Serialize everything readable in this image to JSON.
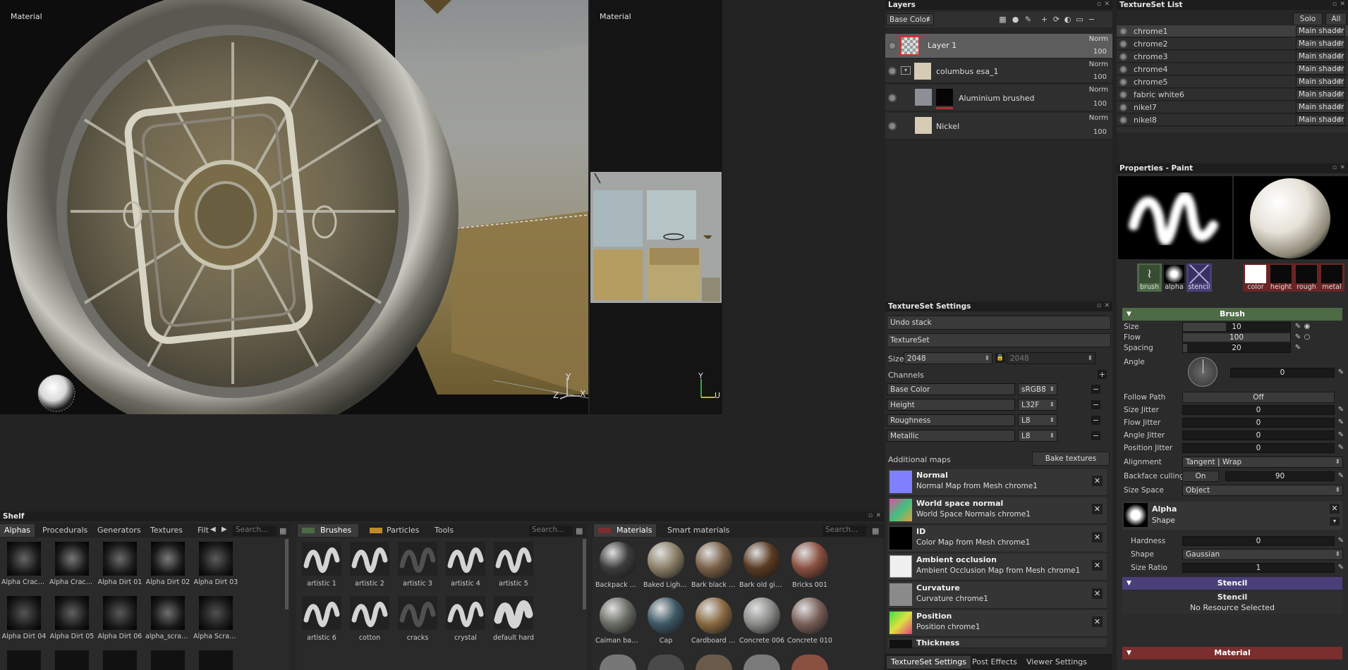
{
  "viewport3d": {
    "label": "Material",
    "axis_y": "Y",
    "axis_z": "Z",
    "axis_x": "X"
  },
  "viewport2d": {
    "label": "Material",
    "axis_y": "Y",
    "axis_u": "U"
  },
  "layers": {
    "title": "Layers",
    "channel": "Base Color",
    "items": [
      {
        "name": "Layer 1",
        "blend": "Norm",
        "opacity": "100"
      },
      {
        "name": "columbus esa_1",
        "blend": "Norm",
        "opacity": "100"
      },
      {
        "name": "Aluminium brushed",
        "blend": "Norm",
        "opacity": "100"
      },
      {
        "name": "Nickel",
        "blend": "Norm",
        "opacity": "100"
      }
    ]
  },
  "textureset_list": {
    "title": "TextureSet List",
    "solo": "Solo",
    "all": "All",
    "items": [
      {
        "name": "chrome1",
        "shader": "Main shader"
      },
      {
        "name": "chrome2",
        "shader": "Main shader"
      },
      {
        "name": "chrome3",
        "shader": "Main shader"
      },
      {
        "name": "chrome4",
        "shader": "Main shader"
      },
      {
        "name": "chrome5",
        "shader": "Main shader"
      },
      {
        "name": "fabric white6",
        "shader": "Main shader"
      },
      {
        "name": "nikel7",
        "shader": "Main shader"
      },
      {
        "name": "nikel8",
        "shader": "Main shader"
      }
    ]
  },
  "ts_settings": {
    "title": "TextureSet Settings",
    "undo": "Undo stack",
    "textureset": "TextureSet",
    "size_label": "Size",
    "size": "2048",
    "size2": "2048",
    "channels_label": "Channels",
    "channels": [
      {
        "name": "Base Color",
        "format": "sRGB8"
      },
      {
        "name": "Height",
        "format": "L32F"
      },
      {
        "name": "Roughness",
        "format": "L8"
      },
      {
        "name": "Metallic",
        "format": "L8"
      }
    ],
    "additional": "Additional maps",
    "bake": "Bake textures",
    "maps": [
      {
        "title": "Normal",
        "sub": "Normal Map from Mesh chrome1"
      },
      {
        "title": "World space normal",
        "sub": "World Space Normals chrome1"
      },
      {
        "title": "ID",
        "sub": "Color Map from Mesh chrome1"
      },
      {
        "title": "Ambient occlusion",
        "sub": "Ambient Occlusion Map from Mesh chrome1"
      },
      {
        "title": "Curvature",
        "sub": "Curvature chrome1"
      },
      {
        "title": "Position",
        "sub": "Position chrome1"
      },
      {
        "title": "Thickness",
        "sub": ""
      }
    ],
    "tabs": [
      "TextureSet Settings",
      "Post Effects",
      "Viewer Settings"
    ]
  },
  "properties": {
    "title": "Properties - Paint",
    "tools": [
      "brush",
      "alpha",
      "stencil"
    ],
    "mats": [
      "color",
      "height",
      "rough",
      "metal"
    ],
    "brush_header": "Brush",
    "size_label": "Size",
    "size": "10",
    "size_frac": 0.4,
    "flow_label": "Flow",
    "flow": "100",
    "flow_frac": 1.0,
    "spacing_label": "Spacing",
    "spacing": "20",
    "spacing_frac": 0.04,
    "angle_label": "Angle",
    "angle": "0",
    "follow_label": "Follow Path",
    "follow": "Off",
    "size_jitter_label": "Size Jitter",
    "size_jitter": "0",
    "flow_jitter_label": "Flow Jitter",
    "flow_jitter": "0",
    "angle_jitter_label": "Angle Jitter",
    "angle_jitter": "0",
    "pos_jitter_label": "Position Jitter",
    "pos_jitter": "0",
    "alignment_label": "Alignment",
    "alignment": "Tangent | Wrap",
    "backface_label": "Backface culling",
    "backface": "On",
    "backface_val": "90",
    "sizespace_label": "Size Space",
    "sizespace": "Object",
    "alpha_title": "Alpha",
    "alpha_sub": "Shape",
    "hardness_label": "Hardness",
    "hardness": "0",
    "shape_label": "Shape",
    "shape": "Gaussian",
    "ratio_label": "Size Ratio",
    "ratio": "1",
    "stencil_header": "Stencil",
    "stencil_title": "Stencil",
    "stencil_sub": "No Resource Selected",
    "material_header": "Material"
  },
  "shelf": {
    "title": "Shelf",
    "tabs": [
      "Alphas",
      "Procedurals",
      "Generators",
      "Textures",
      "Filt"
    ],
    "search": "Search...",
    "alphas": [
      "Alpha Crack...",
      "Alpha Crack...",
      "Alpha Dirt 01",
      "Alpha Dirt 02",
      "Alpha Dirt 03",
      "Alpha Dirt 04",
      "Alpha Dirt 05",
      "Alpha Dirt 06",
      "alpha_scratc...",
      "Alpha Scratc..."
    ],
    "brush_tabs": [
      "Brushes",
      "Particles",
      "Tools"
    ],
    "brushes": [
      "artistic 1",
      "artistic 2",
      "artistic 3",
      "artistic 4",
      "artistic 5",
      "artistic 6",
      "cotton",
      "cracks",
      "crystal",
      "default hard"
    ],
    "mat_tabs": [
      "Materials",
      "Smart materials"
    ],
    "materials": [
      "Backpack pa...",
      "Baked Lighti...",
      "Bark black pi...",
      "Bark old ginko",
      "Bricks 001",
      "Caiman back...",
      "Cap",
      "Cardboard 001",
      "Concrete 006",
      "Concrete 010"
    ]
  },
  "colors": {
    "accent_green": "#4d6b45",
    "stencil_purple": "#4a3f7a",
    "material_red": "#7a2e2e"
  }
}
